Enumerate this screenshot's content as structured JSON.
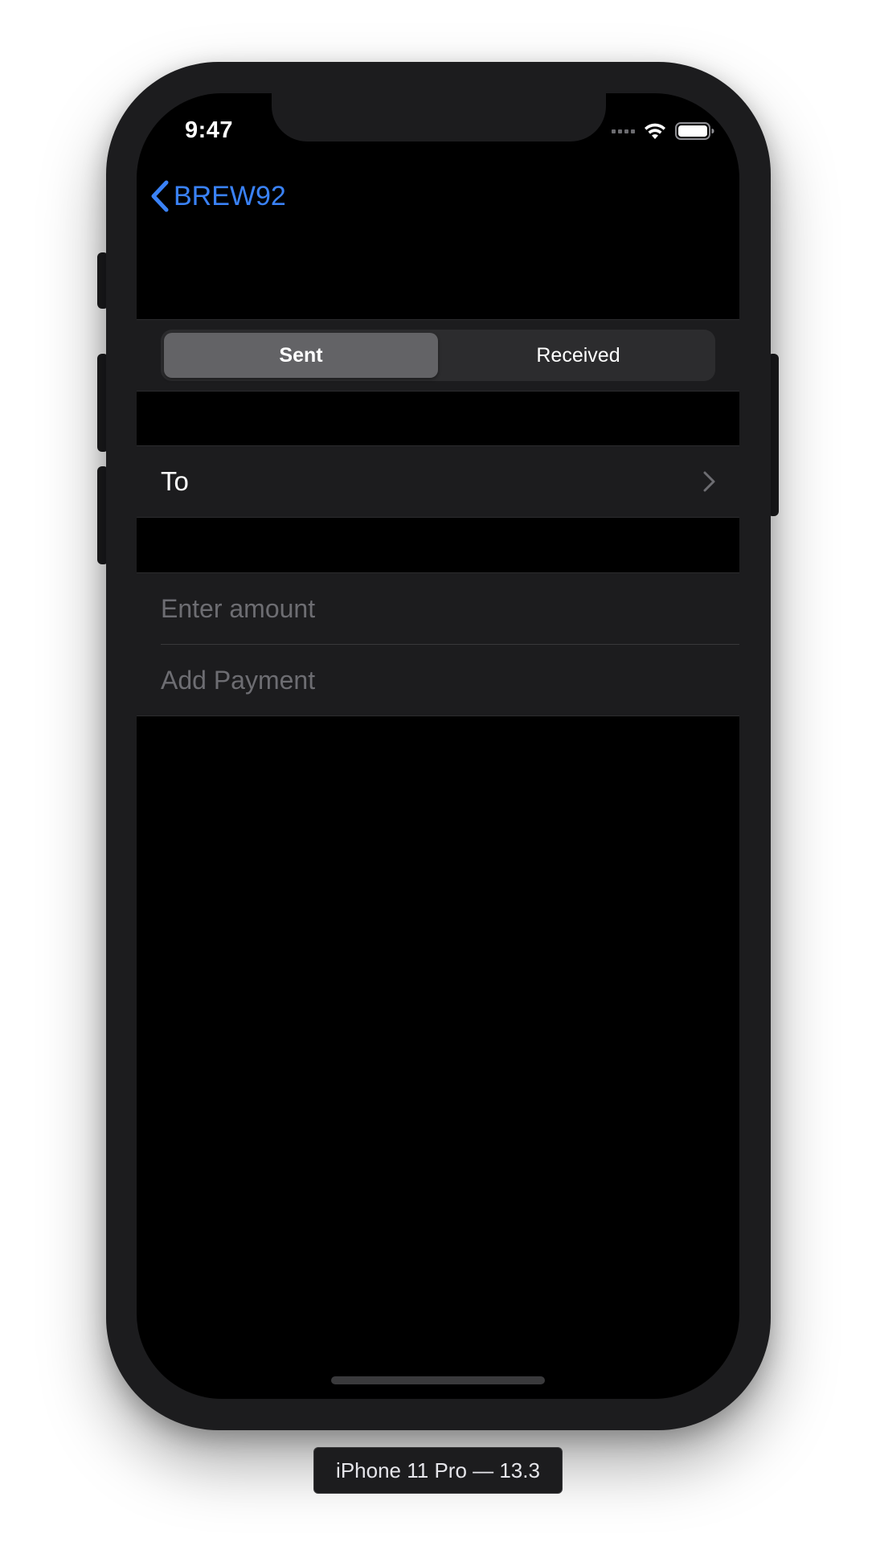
{
  "status_bar": {
    "time": "9:47"
  },
  "nav": {
    "back_label": "BREW92"
  },
  "segmented_control": {
    "options": [
      "Sent",
      "Received"
    ],
    "selected": "Sent"
  },
  "to_row": {
    "label": "To"
  },
  "form": {
    "amount_placeholder": "Enter amount",
    "payment_placeholder": "Add Payment"
  },
  "device": {
    "label": "iPhone 11 Pro — 13.3"
  },
  "colors": {
    "accent": "#3a82f7",
    "background": "#000000",
    "cell_background": "#1c1c1e",
    "segment_selected": "#636366",
    "placeholder": "#6d6d72"
  }
}
